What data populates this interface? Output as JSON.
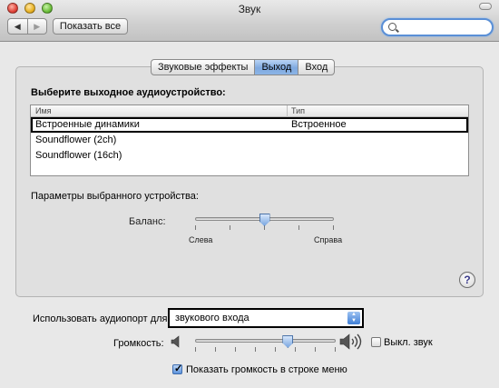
{
  "window": {
    "title": "Звук"
  },
  "toolbar": {
    "back_glyph": "◀",
    "forward_glyph": "▶",
    "show_all_label": "Показать все",
    "search_value": "",
    "search_placeholder": ""
  },
  "tabs": [
    {
      "label": "Звуковые эффекты",
      "active": false
    },
    {
      "label": "Выход",
      "active": true
    },
    {
      "label": "Вход",
      "active": false
    }
  ],
  "output": {
    "heading": "Выберите выходное аудиоустройство:",
    "columns": [
      "Имя",
      "Тип"
    ],
    "devices": [
      {
        "name": "Встроенные динамики",
        "type": "Встроенное",
        "selected": true
      },
      {
        "name": "Soundflower (2ch)",
        "type": "",
        "selected": false
      },
      {
        "name": "Soundflower (16ch)",
        "type": "",
        "selected": false
      }
    ]
  },
  "device_settings": {
    "heading": "Параметры выбранного устройства:",
    "balance_label": "Баланс:",
    "balance_value": 0.5,
    "left_label": "Слева",
    "right_label": "Справа"
  },
  "help_glyph": "?",
  "audioport": {
    "label": "Использовать аудиопорт для:",
    "value": "звукового входа"
  },
  "volume": {
    "label": "Громкость:",
    "value": 0.66,
    "mute_label": "Выкл. звук",
    "mute_checked": false,
    "show_in_menu_label": "Показать громкость в строке меню",
    "show_in_menu_checked": true
  },
  "colors": {
    "accent": "#7fa9df",
    "selection_border": "#000000",
    "window_bg": "#e8e8e8",
    "search_focus": "#5a8fd6"
  }
}
